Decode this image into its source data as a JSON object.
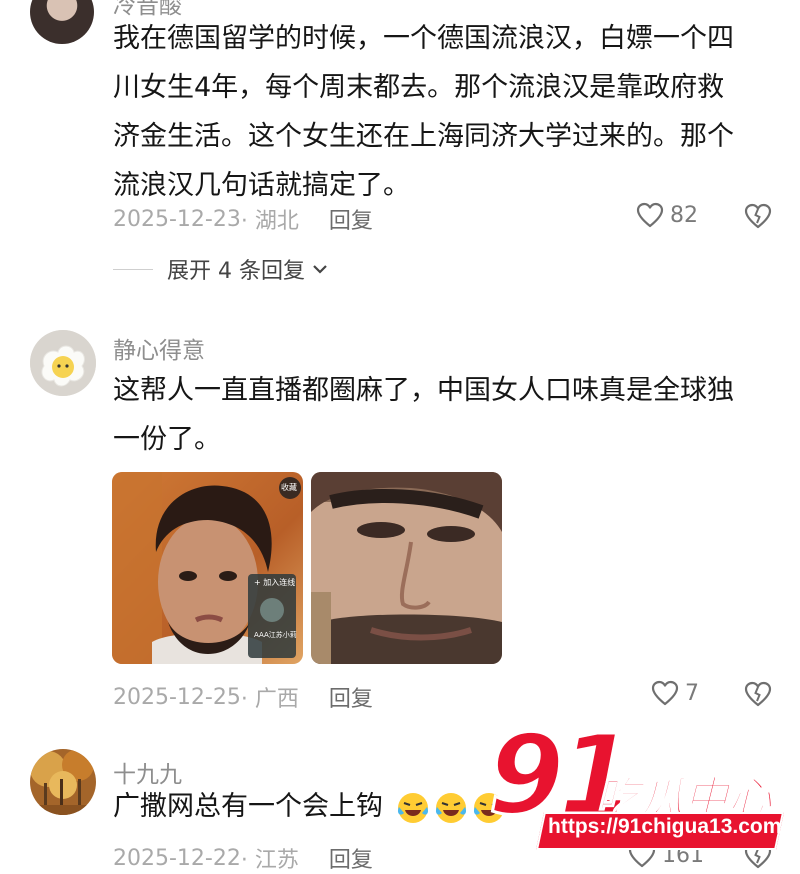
{
  "comments": [
    {
      "username": "冷昔酸",
      "lines": [
        "我在德国留学的时候，一个德国流浪汉，白嫖一个四",
        "川女生4年，每个周末都去。那个流浪汉是靠政府救",
        "济金生活。这个女生还在上海同济大学过来的。那个",
        "流浪汉几句话就搞定了。"
      ],
      "date": "2025-12-23",
      "location": "· 湖北",
      "reply_label": "回复",
      "likes": "82",
      "expand_label": "展开 4 条回复"
    },
    {
      "username": "静心得意",
      "lines": [
        "这帮人一直直播都圈麻了，中国女人口味真是全球独",
        "一份了。"
      ],
      "photo_overlay": {
        "badge": "收藏",
        "join": "+ 加入连线",
        "caption": "AAA江苏小莉"
      },
      "date": "2025-12-25",
      "location": "· 广西",
      "reply_label": "回复",
      "likes": "7"
    },
    {
      "username": "十九九",
      "lines": [
        "广撒网总有一个会上钩"
      ],
      "emojis": [
        "laugh-cry-emoji",
        "laugh-cry-emoji",
        "laugh-cry-emoji"
      ],
      "date": "2025-12-22",
      "location": "· 江苏",
      "reply_label": "回复",
      "likes": "161"
    }
  ],
  "watermark": {
    "number": "91",
    "name": "吃瓜中心",
    "url": "https://91chigua13.com"
  },
  "colors": {
    "text": "#161616",
    "muted": "#a9a9a9",
    "watermark_red": "#e8132f"
  }
}
